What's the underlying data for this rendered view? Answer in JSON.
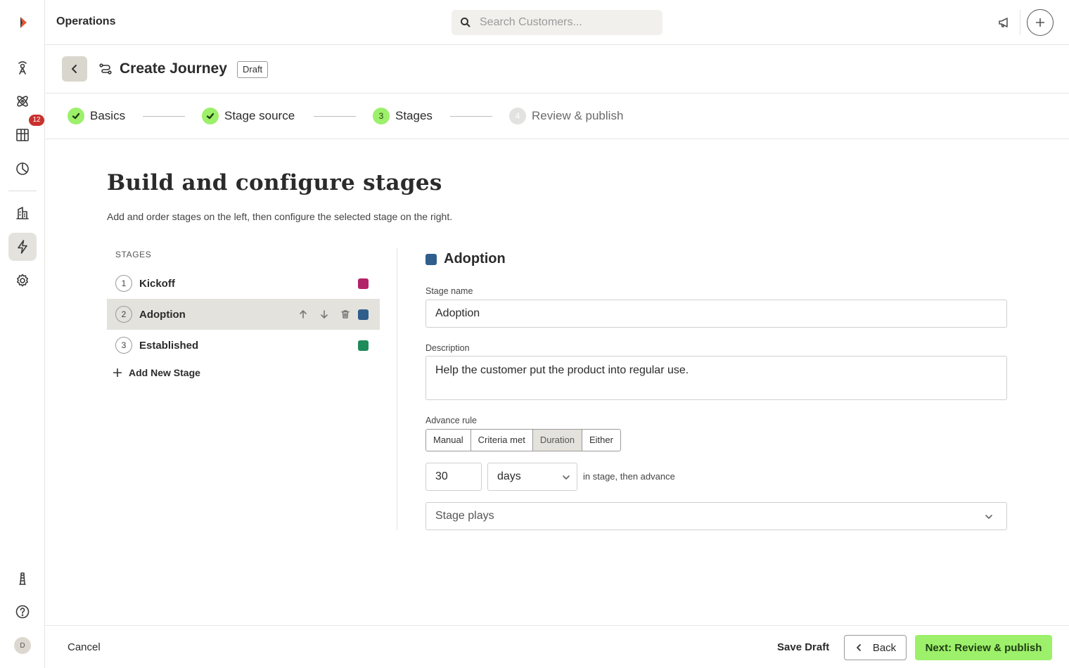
{
  "topbar": {
    "title": "Operations",
    "search_placeholder": "Search Customers..."
  },
  "rail": {
    "notification_count": "12",
    "avatar_initial": "D"
  },
  "header": {
    "title": "Create Journey",
    "status": "Draft"
  },
  "stepper": {
    "steps": [
      {
        "label": "Basics",
        "state": "done"
      },
      {
        "label": "Stage source",
        "state": "done"
      },
      {
        "label": "Stages",
        "number": "3",
        "state": "current"
      },
      {
        "label": "Review & publish",
        "number": "4",
        "state": "future"
      }
    ]
  },
  "main": {
    "title": "Build and configure stages",
    "subtitle": "Add and order stages on the left, then configure the selected stage on the right."
  },
  "stages": {
    "heading": "STAGES",
    "items": [
      {
        "number": "1",
        "name": "Kickoff",
        "color": "#b2236a"
      },
      {
        "number": "2",
        "name": "Adoption",
        "color": "#2f5e8c",
        "selected": true
      },
      {
        "number": "3",
        "name": "Established",
        "color": "#1f8a5a"
      }
    ],
    "add_label": "Add New Stage"
  },
  "detail": {
    "title": "Adoption",
    "color": "#2f5e8c",
    "stage_name_label": "Stage name",
    "stage_name_value": "Adoption",
    "description_label": "Description",
    "description_value": "Help the customer put the product into regular use.",
    "advance_rule_label": "Advance rule",
    "advance_options": [
      "Manual",
      "Criteria met",
      "Duration",
      "Either"
    ],
    "advance_selected": "Duration",
    "duration_value": "30",
    "duration_unit": "days",
    "duration_note": "in stage, then advance",
    "plays_placeholder": "Stage plays"
  },
  "footer": {
    "cancel": "Cancel",
    "save_draft": "Save Draft",
    "back": "Back",
    "next": "Next: Review & publish"
  },
  "colors": {
    "accent": "#9df06a",
    "selected_bg": "#e4e2dc",
    "badge": "#c8322e"
  }
}
